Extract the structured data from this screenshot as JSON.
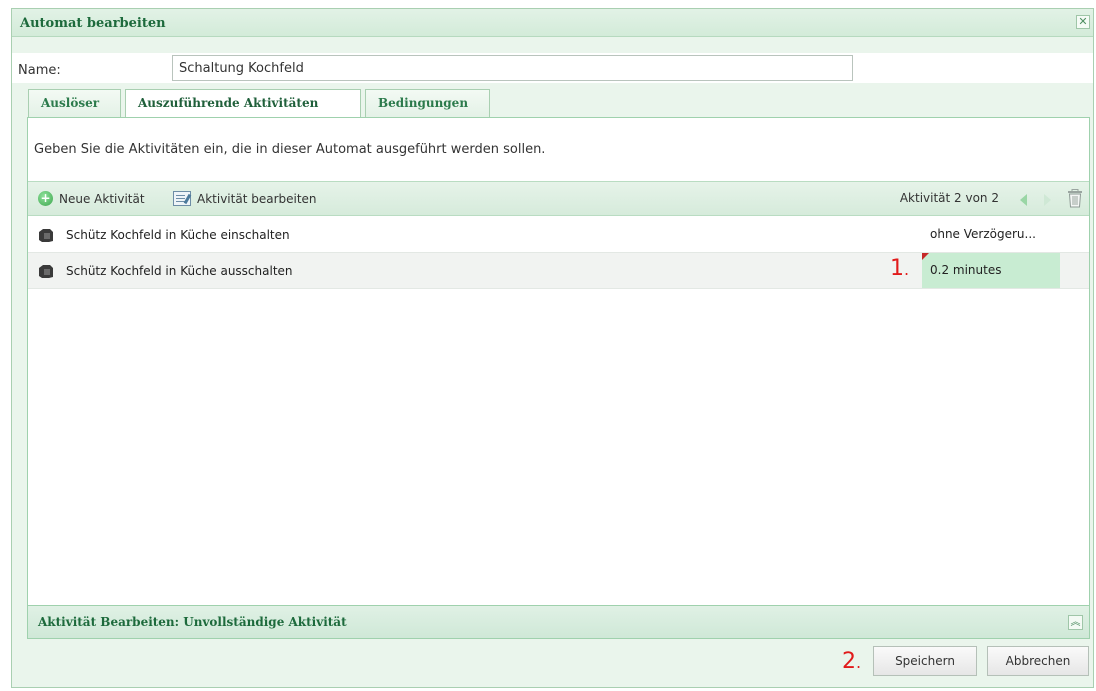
{
  "dialog": {
    "title": "Automat bearbeiten",
    "close_icon": "close-icon"
  },
  "name_field": {
    "label": "Name:",
    "value": "Schaltung Kochfeld"
  },
  "tabs": [
    {
      "label": "Auslöser",
      "active": false
    },
    {
      "label": "Auszuführende Aktivitäten",
      "active": true
    },
    {
      "label": "Bedingungen",
      "active": false
    }
  ],
  "panel": {
    "description": "Geben Sie die Aktivitäten ein, die in dieser Automat ausgeführt werden sollen."
  },
  "toolbar": {
    "new_label": "Neue Aktivität",
    "new_icon": "plus-circle-icon",
    "edit_label": "Aktivität bearbeiten",
    "edit_icon": "edit-list-icon",
    "pager": "Aktivität 2 von 2",
    "prev_icon": "arrow-left-icon",
    "next_icon": "arrow-right-icon",
    "delete_icon": "trash-icon"
  },
  "activities": [
    {
      "label": "Schütz Kochfeld in Küche einschalten",
      "delay": "ohne Verzögeru...",
      "selected": false
    },
    {
      "label": "Schütz Kochfeld in Küche ausschalten",
      "delay": "0.2 minutes",
      "selected": true
    }
  ],
  "annotations": {
    "marker_1": "1",
    "marker_2": "2",
    "marker_color": "#e11b1b"
  },
  "subpanel": {
    "title": "Aktivität Bearbeiten: Unvollständige Aktivität",
    "collapse_icon": "double-chevron-up-icon"
  },
  "footer": {
    "save_label": "Speichern",
    "cancel_label": "Abbrechen"
  },
  "colors": {
    "accent": "#1d6a3c",
    "header_bg": "#d3ebd9",
    "selection": "#c8ecd2"
  }
}
